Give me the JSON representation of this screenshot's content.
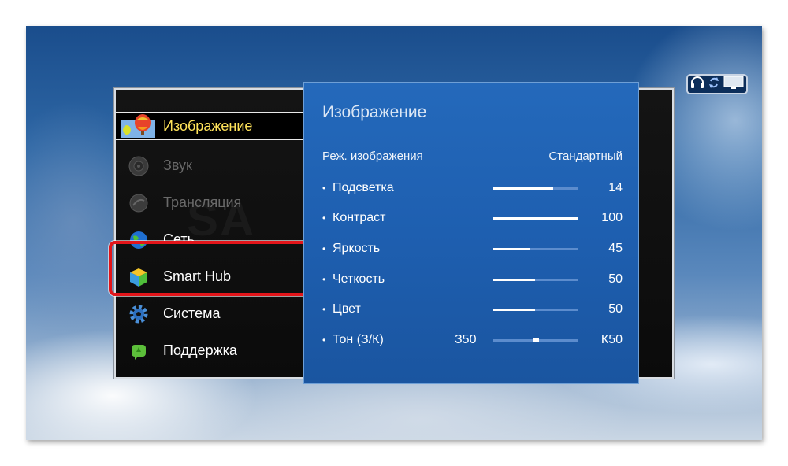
{
  "watermark": "SA",
  "menu": {
    "items": [
      {
        "label": "Изображение",
        "icon": "balloon-icon",
        "state": "selected"
      },
      {
        "label": "Звук",
        "icon": "speaker-icon",
        "state": "dim"
      },
      {
        "label": "Трансляция",
        "icon": "satellite-icon",
        "state": "dim"
      },
      {
        "label": "Сеть",
        "icon": "globe-icon",
        "state": "normal"
      },
      {
        "label": "Smart Hub",
        "icon": "cube-icon",
        "state": "normal"
      },
      {
        "label": "Система",
        "icon": "gear-icon",
        "state": "normal"
      },
      {
        "label": "Поддержка",
        "icon": "support-icon",
        "state": "normal"
      }
    ]
  },
  "panel": {
    "title": "Изображение",
    "mode_label": "Реж. изображения",
    "mode_value": "Стандартный",
    "settings": [
      {
        "label": "Подсветка",
        "value": "14",
        "level": 0.7
      },
      {
        "label": "Контраст",
        "value": "100",
        "level": 1.0
      },
      {
        "label": "Яркость",
        "value": "45",
        "level": 0.43
      },
      {
        "label": "Четкость",
        "value": "50",
        "level": 0.49
      },
      {
        "label": "Цвет",
        "value": "50",
        "level": 0.49
      },
      {
        "label": "Тон (З/К)",
        "left_value": "З50",
        "value": "К50",
        "level": 0.5,
        "balance": true
      }
    ]
  },
  "status_icons": [
    "headphones-icon",
    "sync-icon",
    "tv-icon"
  ],
  "colors": {
    "panel_blue": "#1e5fb0",
    "selected_text": "#ffe35a",
    "highlight_red": "#e3151a"
  }
}
